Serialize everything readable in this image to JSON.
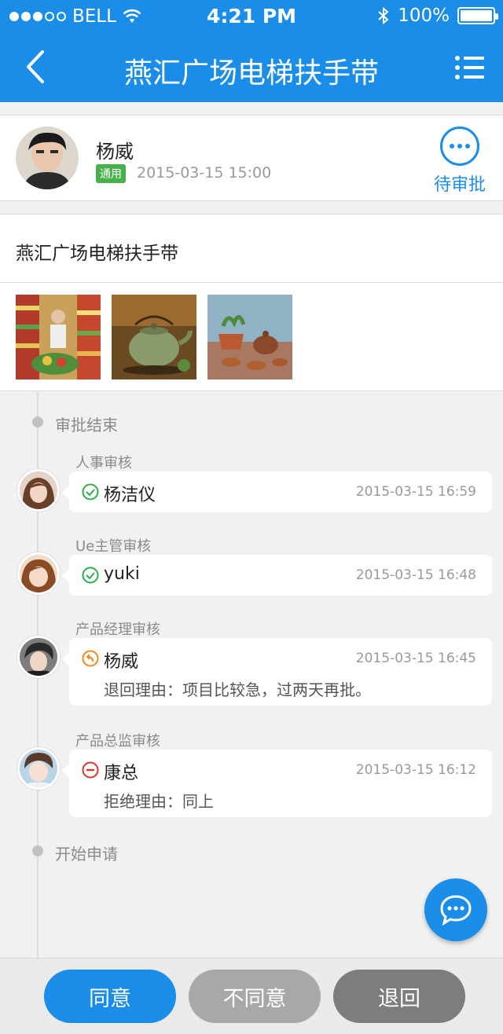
{
  "status_bar": {
    "carrier": "BELL",
    "time": "4:21 PM",
    "battery": "100%",
    "battery_level": 1.0
  },
  "nav": {
    "title": "燕汇广场电梯扶手带",
    "back_icon": "chevron-left-icon",
    "menu_icon": "list-menu-icon"
  },
  "applicant": {
    "name": "杨威",
    "tag": "通用",
    "time": "2015-03-15 15:00",
    "status_label": "待审批"
  },
  "request": {
    "title": "燕汇广场电梯扶手带",
    "attachments": [
      "supermarket-photo",
      "teapot-photo",
      "tea-set-photo"
    ]
  },
  "timeline": {
    "end_label": "审批结束",
    "start_label": "开始申请",
    "steps": [
      {
        "role": "人事审核",
        "name": "杨洁仪",
        "time": "2015-03-15 16:59",
        "result": "approved",
        "reason": ""
      },
      {
        "role": "Ue主管审核",
        "name": "yuki",
        "time": "2015-03-15 16:48",
        "result": "approved",
        "reason": ""
      },
      {
        "role": "产品经理审核",
        "name": "杨威",
        "time": "2015-03-15 16:45",
        "result": "returned",
        "reason": "退回理由：项目比较急，过两天再批。"
      },
      {
        "role": "产品总监审核",
        "name": "康总",
        "time": "2015-03-15 16:12",
        "result": "rejected",
        "reason": "拒绝理由：同上"
      }
    ]
  },
  "actions": {
    "agree": "同意",
    "disagree": "不同意",
    "return": "退回"
  },
  "colors": {
    "primary": "#1a8de8",
    "approved": "#2bb14a",
    "returned": "#f08a1c",
    "rejected": "#e0342c"
  }
}
